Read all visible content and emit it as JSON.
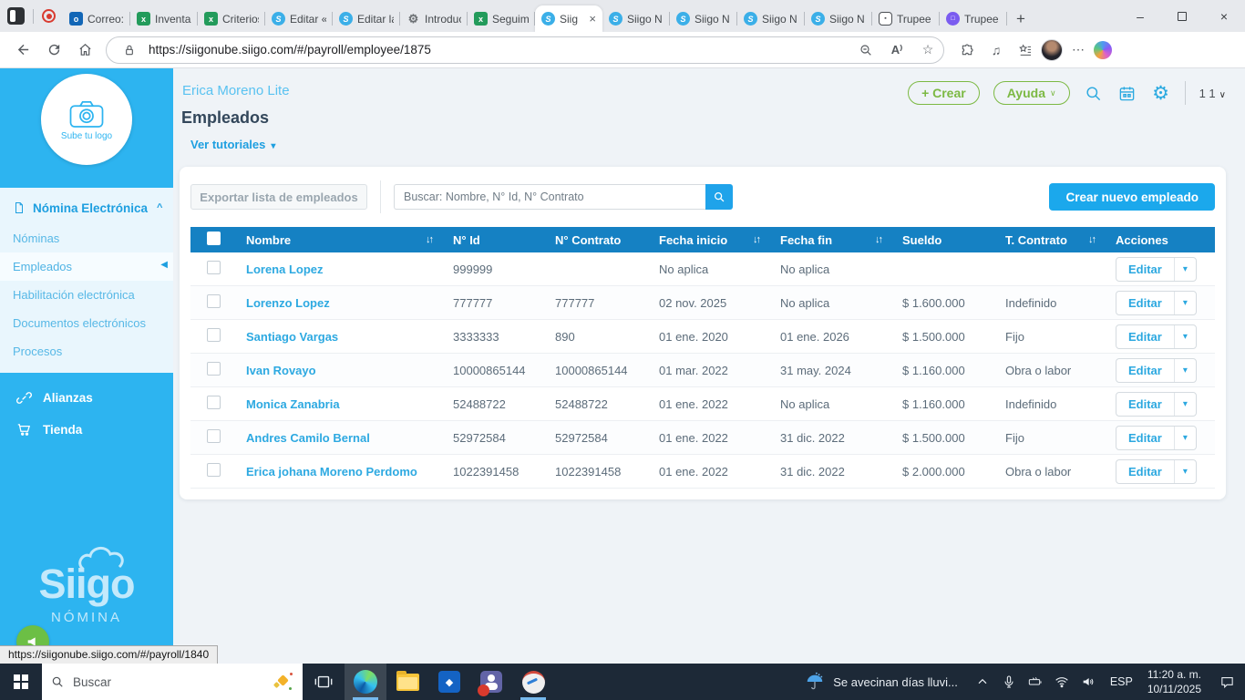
{
  "browser": {
    "tabs": [
      {
        "label": "Correo:",
        "icon": "outlook"
      },
      {
        "label": "Inventar",
        "icon": "excel"
      },
      {
        "label": "Criterios",
        "icon": "excel"
      },
      {
        "label": "Editar «",
        "icon": "siigo"
      },
      {
        "label": "Editar la",
        "icon": "siigo"
      },
      {
        "label": "Introduc",
        "icon": "chatgpt"
      },
      {
        "label": "Seguimi",
        "icon": "excel"
      },
      {
        "label": "Siig",
        "icon": "siigo"
      },
      {
        "label": "Siigo N",
        "icon": "siigo"
      },
      {
        "label": "Siigo N",
        "icon": "siigo"
      },
      {
        "label": "Siigo N",
        "icon": "siigo"
      },
      {
        "label": "Siigo N",
        "icon": "siigo"
      },
      {
        "label": "Trupee",
        "icon": "trupeer-light"
      },
      {
        "label": "Trupee",
        "icon": "trupeer-purple"
      }
    ],
    "url": "https://siigonube.siigo.com/#/payroll/employee/1875"
  },
  "sidebar": {
    "logo_circle_label": "Sube tu logo",
    "menu_title": "Nómina Electrónica",
    "items": [
      {
        "label": "Nóminas"
      },
      {
        "label": "Empleados"
      },
      {
        "label": "Habilitación electrónica"
      },
      {
        "label": "Documentos electrónicos"
      },
      {
        "label": "Procesos"
      }
    ],
    "links": [
      {
        "label": "Alianzas"
      },
      {
        "label": "Tienda"
      }
    ],
    "brand": "Siigo",
    "brand_sub": "NÓMINA"
  },
  "header": {
    "company": "Erica Moreno Lite",
    "page_title": "Empleados",
    "tutorials_link": "Ver tutoriales",
    "create_button": "+ Crear",
    "help_button": "Ayuda",
    "page_indicator": "1 1"
  },
  "toolbar": {
    "export_button": "Exportar lista de empleados",
    "search_placeholder": "Buscar: Nombre, N° Id, N° Contrato",
    "new_employee_button": "Crear nuevo empleado"
  },
  "table": {
    "columns": [
      "Nombre",
      "N° Id",
      "N° Contrato",
      "Fecha inicio",
      "Fecha fin",
      "Sueldo",
      "T. Contrato",
      "Acciones"
    ],
    "edit_label": "Editar",
    "rows": [
      {
        "name": "Lorena Lopez",
        "id": "999999",
        "contract": "",
        "start": "No aplica",
        "end": "No aplica",
        "salary": "",
        "type": ""
      },
      {
        "name": "Lorenzo Lopez",
        "id": "777777",
        "contract": "777777",
        "start": "02 nov. 2025",
        "end": "No aplica",
        "salary": "$ 1.600.000",
        "type": "Indefinido"
      },
      {
        "name": "Santiago Vargas",
        "id": "3333333",
        "contract": "890",
        "start": "01 ene. 2020",
        "end": "01 ene. 2026",
        "salary": "$ 1.500.000",
        "type": "Fijo"
      },
      {
        "name": "Ivan Rovayo",
        "id": "10000865144",
        "contract": "10000865144",
        "start": "01 mar. 2022",
        "end": "31 may. 2024",
        "salary": "$ 1.160.000",
        "type": "Obra o labor"
      },
      {
        "name": "Monica Zanabria",
        "id": "52488722",
        "contract": "52488722",
        "start": "01 ene. 2022",
        "end": "No aplica",
        "salary": "$ 1.160.000",
        "type": "Indefinido"
      },
      {
        "name": "Andres Camilo Bernal",
        "id": "52972584",
        "contract": "52972584",
        "start": "01 ene. 2022",
        "end": "31 dic. 2022",
        "salary": "$ 1.500.000",
        "type": "Fijo"
      },
      {
        "name": "Erica johana Moreno Perdomo",
        "id": "1022391458",
        "contract": "1022391458",
        "start": "01 ene. 2022",
        "end": "31 dic. 2022",
        "salary": "$ 2.000.000",
        "type": "Obra o labor"
      }
    ]
  },
  "status_link": "https://siigonube.siigo.com/#/payroll/1840",
  "taskbar": {
    "search_placeholder": "Buscar",
    "weather_text": "Se avecinan días lluvi...",
    "language": "ESP",
    "time": "11:20 a. m.",
    "date": "10/11/2025"
  },
  "icons": {
    "sort": "↓↑",
    "caret_down": "▾",
    "chevron_down": "∨",
    "chevron_up": "^",
    "active_item_marker": "◀",
    "sidebar_collapse": "‹",
    "overflow_menu": "⋯",
    "new_tab": "+",
    "minimize": "–",
    "close": "×",
    "favorites_star": "☆",
    "media": "♫"
  }
}
